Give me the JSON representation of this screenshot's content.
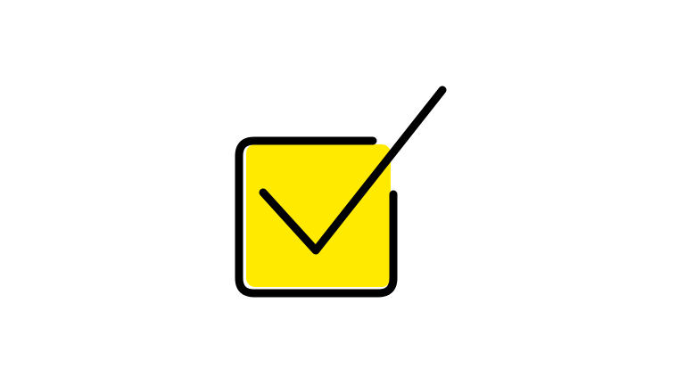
{
  "icon": {
    "name": "checkbox-checked-icon",
    "box_fill": "#FFEA00",
    "stroke_color": "#000000",
    "background": "#FFFFFF"
  }
}
